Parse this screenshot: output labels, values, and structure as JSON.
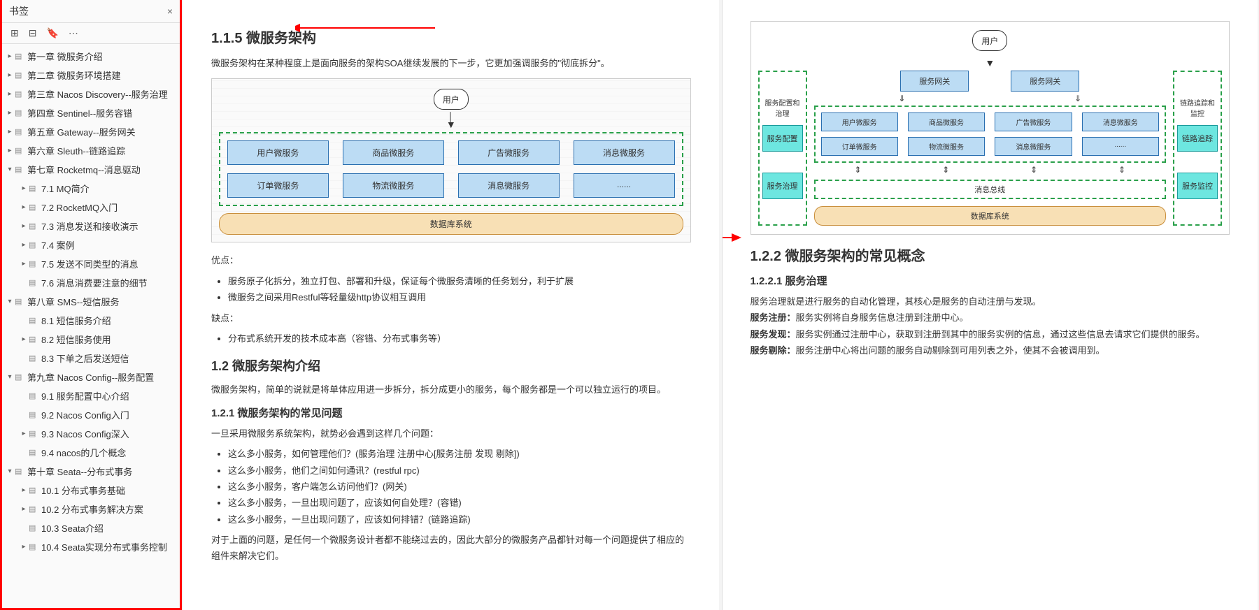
{
  "sidebar": {
    "title": "书签",
    "items": [
      {
        "label": "第一章 微服务介绍",
        "level": 0,
        "expandable": true
      },
      {
        "label": "第二章 微服务环境搭建",
        "level": 0,
        "expandable": true
      },
      {
        "label": "第三章 Nacos Discovery--服务治理",
        "level": 0,
        "expandable": true
      },
      {
        "label": "第四章 Sentinel--服务容错",
        "level": 0,
        "expandable": true
      },
      {
        "label": "第五章 Gateway--服务网关",
        "level": 0,
        "expandable": true
      },
      {
        "label": "第六章 Sleuth--链路追踪",
        "level": 0,
        "expandable": true
      },
      {
        "label": "第七章 Rocketmq--消息驱动",
        "level": 0,
        "expandable": true,
        "open": true
      },
      {
        "label": "7.1 MQ简介",
        "level": 1,
        "expandable": true
      },
      {
        "label": "7.2 RocketMQ入门",
        "level": 1,
        "expandable": true
      },
      {
        "label": "7.3 消息发送和接收演示",
        "level": 1,
        "expandable": true
      },
      {
        "label": "7.4 案例",
        "level": 1,
        "expandable": true
      },
      {
        "label": "7.5 发送不同类型的消息",
        "level": 1,
        "expandable": true
      },
      {
        "label": "7.6 消息消费要注意的细节",
        "level": 1,
        "expandable": false
      },
      {
        "label": "第八章 SMS--短信服务",
        "level": 0,
        "expandable": true,
        "open": true
      },
      {
        "label": "8.1 短信服务介绍",
        "level": 1,
        "expandable": false
      },
      {
        "label": "8.2 短信服务使用",
        "level": 1,
        "expandable": true
      },
      {
        "label": "8.3 下单之后发送短信",
        "level": 1,
        "expandable": false
      },
      {
        "label": "第九章 Nacos Config--服务配置",
        "level": 0,
        "expandable": true,
        "open": true
      },
      {
        "label": "9.1 服务配置中心介绍",
        "level": 1,
        "expandable": false
      },
      {
        "label": "9.2 Nacos Config入门",
        "level": 1,
        "expandable": false
      },
      {
        "label": "9.3 Nacos Config深入",
        "level": 1,
        "expandable": true
      },
      {
        "label": "9.4 nacos的几个概念",
        "level": 1,
        "expandable": false
      },
      {
        "label": "第十章 Seata--分布式事务",
        "level": 0,
        "expandable": true,
        "open": true
      },
      {
        "label": "10.1 分布式事务基础",
        "level": 1,
        "expandable": true
      },
      {
        "label": "10.2 分布式事务解决方案",
        "level": 1,
        "expandable": true
      },
      {
        "label": "10.3 Seata介绍",
        "level": 1,
        "expandable": false
      },
      {
        "label": "10.4 Seata实现分布式事务控制",
        "level": 1,
        "expandable": true
      }
    ]
  },
  "page1": {
    "h1": "1.1.5 微服务架构",
    "intro": "微服务架构在某种程度上是面向服务的架构SOA继续发展的下一步，它更加强调服务的\"彻底拆分\"。",
    "diagram": {
      "user": "用户",
      "row1": [
        "用户微服务",
        "商品微服务",
        "广告微服务",
        "消息微服务"
      ],
      "row2": [
        "订单微服务",
        "物流微服务",
        "消息微服务",
        "......"
      ],
      "db": "数据库系统"
    },
    "pros_title": "优点：",
    "pros": [
      "服务原子化拆分，独立打包、部署和升级，保证每个微服务清晰的任务划分，利于扩展",
      "微服务之间采用Restful等轻量级http协议相互调用"
    ],
    "cons_title": "缺点：",
    "cons": [
      "分布式系统开发的技术成本高（容错、分布式事务等）"
    ],
    "h2": "1.2 微服务架构介绍",
    "p2": "微服务架构，简单的说就是将单体应用进一步拆分，拆分成更小的服务，每个服务都是一个可以独立运行的项目。",
    "h3": "1.2.1 微服务架构的常见问题",
    "p3": "一旦采用微服务系统架构，就势必会遇到这样几个问题：",
    "qs": [
      "这么多小服务，如何管理他们？(服务治理 注册中心[服务注册 发现 剔除])",
      "这么多小服务，他们之间如何通讯？(restful rpc)",
      "这么多小服务，客户端怎么访问他们？(网关)",
      "这么多小服务，一旦出现问题了，应该如何自处理？(容错)",
      "这么多小服务，一旦出现问题了，应该如何排错？(链路追踪)"
    ],
    "p4": "对于上面的问题，是任何一个微服务设计者都不能绕过去的，因此大部分的微服务产品都针对每一个问题提供了相应的组件来解决它们。"
  },
  "page2": {
    "diagram": {
      "user": "用户",
      "left_title": "服务配置和治理",
      "left": [
        "服务配置",
        "服务治理"
      ],
      "right_title": "链路追踪和监控",
      "right": [
        "链路追踪",
        "服务监控"
      ],
      "gateways": [
        "服务网关",
        "服务网关"
      ],
      "row1": [
        "用户微服务",
        "商品微服务",
        "广告微服务",
        "消息微服务"
      ],
      "row2": [
        "订单微服务",
        "物流微服务",
        "消息微服务",
        "......"
      ],
      "bus": "消息总线",
      "db": "数据库系统"
    },
    "h1": "1.2.2 微服务架构的常见概念",
    "h2": "1.2.2.1 服务治理",
    "p1": "服务治理就是进行服务的自动化管理，其核心是服务的自动注册与发现。",
    "reg_label": "服务注册：",
    "reg": "服务实例将自身服务信息注册到注册中心。",
    "disc_label": "服务发现：",
    "disc": "服务实例通过注册中心，获取到注册到其中的服务实例的信息，通过这些信息去请求它们提供的服务。",
    "del_label": "服务剔除：",
    "del": "服务注册中心将出问题的服务自动剔除到可用列表之外，使其不会被调用到。"
  }
}
